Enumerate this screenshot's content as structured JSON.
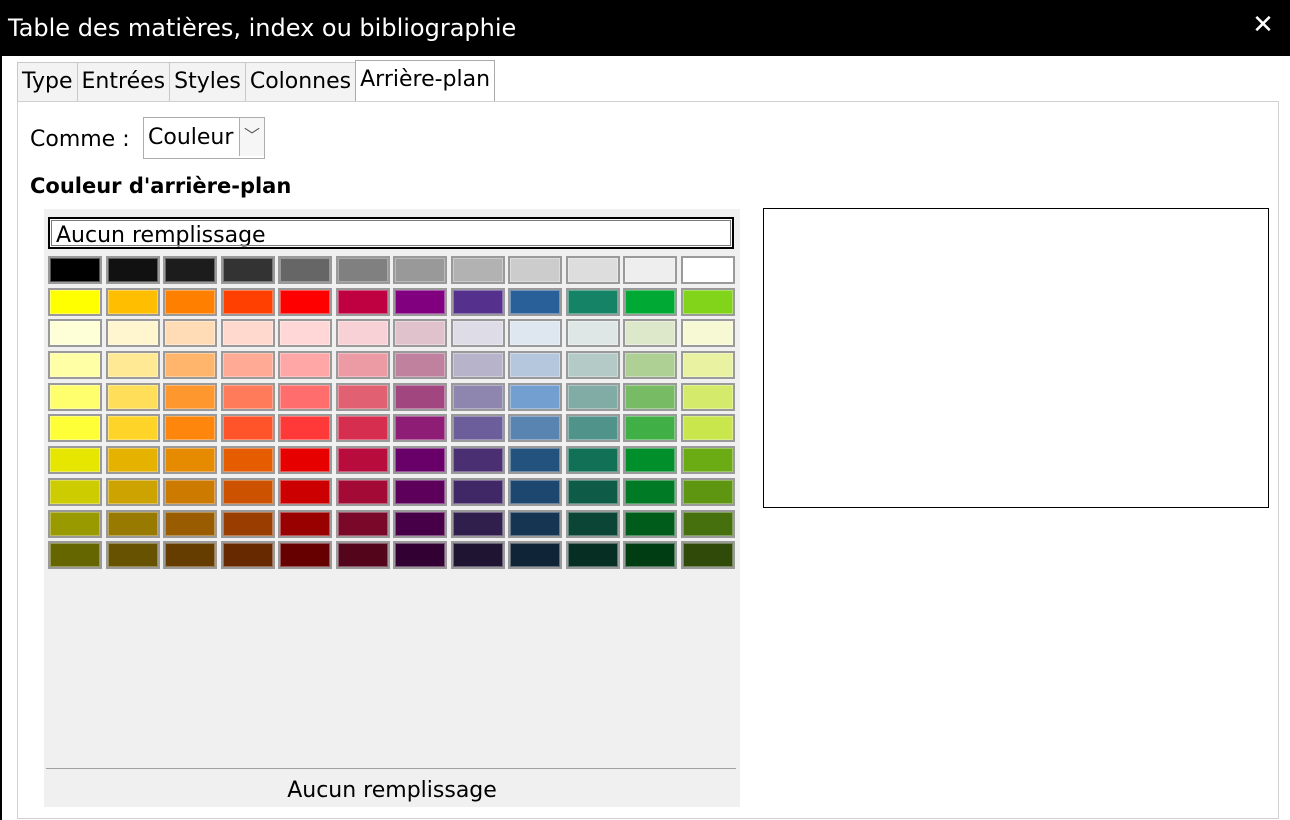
{
  "window": {
    "title": "Table des matières, index ou bibliographie",
    "close_glyph": "✕"
  },
  "tabs": [
    {
      "label": "Type",
      "active": false
    },
    {
      "label": "Entrées",
      "active": false
    },
    {
      "label": "Styles",
      "active": false
    },
    {
      "label": "Colonnes",
      "active": false
    },
    {
      "label": "Arrière-plan",
      "active": true
    }
  ],
  "comme": {
    "label": "Comme :",
    "value": "Couleur"
  },
  "section_heading": "Couleur d'arrière-plan",
  "palette": {
    "none_button": "Aucun remplissage",
    "selected_label": "Aucun remplissage",
    "rows": [
      [
        "#000000",
        "#111111",
        "#1c1c1c",
        "#333333",
        "#666666",
        "#808080",
        "#999999",
        "#b2b2b2",
        "#cccccc",
        "#dddddd",
        "#eeeeee",
        "#ffffff"
      ],
      [
        "#ffff00",
        "#ffbf00",
        "#ff8000",
        "#ff4000",
        "#ff0000",
        "#bf0041",
        "#800080",
        "#55308d",
        "#2a6099",
        "#158466",
        "#00a933",
        "#81d41a"
      ],
      [
        "#ffffd7",
        "#fff5ce",
        "#ffdbb6",
        "#ffd8ce",
        "#ffd7d7",
        "#f7d1d5",
        "#e0c2cd",
        "#dedce6",
        "#dee6ef",
        "#dee7e5",
        "#dde8cb",
        "#f6f9d4"
      ],
      [
        "#ffffa6",
        "#ffe994",
        "#ffb66c",
        "#ffaa95",
        "#ffa6a6",
        "#ec9ba4",
        "#bf819e",
        "#b7b3ca",
        "#b4c7dc",
        "#b3cac7",
        "#afd095",
        "#e8f2a1"
      ],
      [
        "#ffff6d",
        "#ffde59",
        "#ff972f",
        "#ff7b59",
        "#ff6d6d",
        "#e16173",
        "#a1467e",
        "#8e86ae",
        "#729fcf",
        "#81aca6",
        "#77bc65",
        "#d4ea6b"
      ],
      [
        "#ffff38",
        "#ffd428",
        "#ff860d",
        "#ff5429",
        "#ff3838",
        "#d62e4e",
        "#8d1d75",
        "#6b5e9b",
        "#5983b0",
        "#50938a",
        "#3faf46",
        "#c9e64c"
      ],
      [
        "#e6e600",
        "#e6b200",
        "#e68a00",
        "#e65c00",
        "#e60000",
        "#b80c3c",
        "#690069",
        "#4b2f73",
        "#23527e",
        "#127056",
        "#008f2b",
        "#6bab14"
      ],
      [
        "#cccc00",
        "#cca300",
        "#cc7a00",
        "#cc5200",
        "#cc0000",
        "#a30a35",
        "#5c005c",
        "#402866",
        "#1e476f",
        "#0e5c47",
        "#007a24",
        "#5e9612"
      ],
      [
        "#999900",
        "#997a00",
        "#995c00",
        "#993d00",
        "#990000",
        "#7a0828",
        "#470047",
        "#301f4d",
        "#163552",
        "#0a4535",
        "#005c1b",
        "#46700d"
      ],
      [
        "#666600",
        "#665200",
        "#663d00",
        "#662900",
        "#660000",
        "#52051b",
        "#330033",
        "#201433",
        "#0f2436",
        "#072e23",
        "#003d12",
        "#2f4a09"
      ]
    ]
  }
}
